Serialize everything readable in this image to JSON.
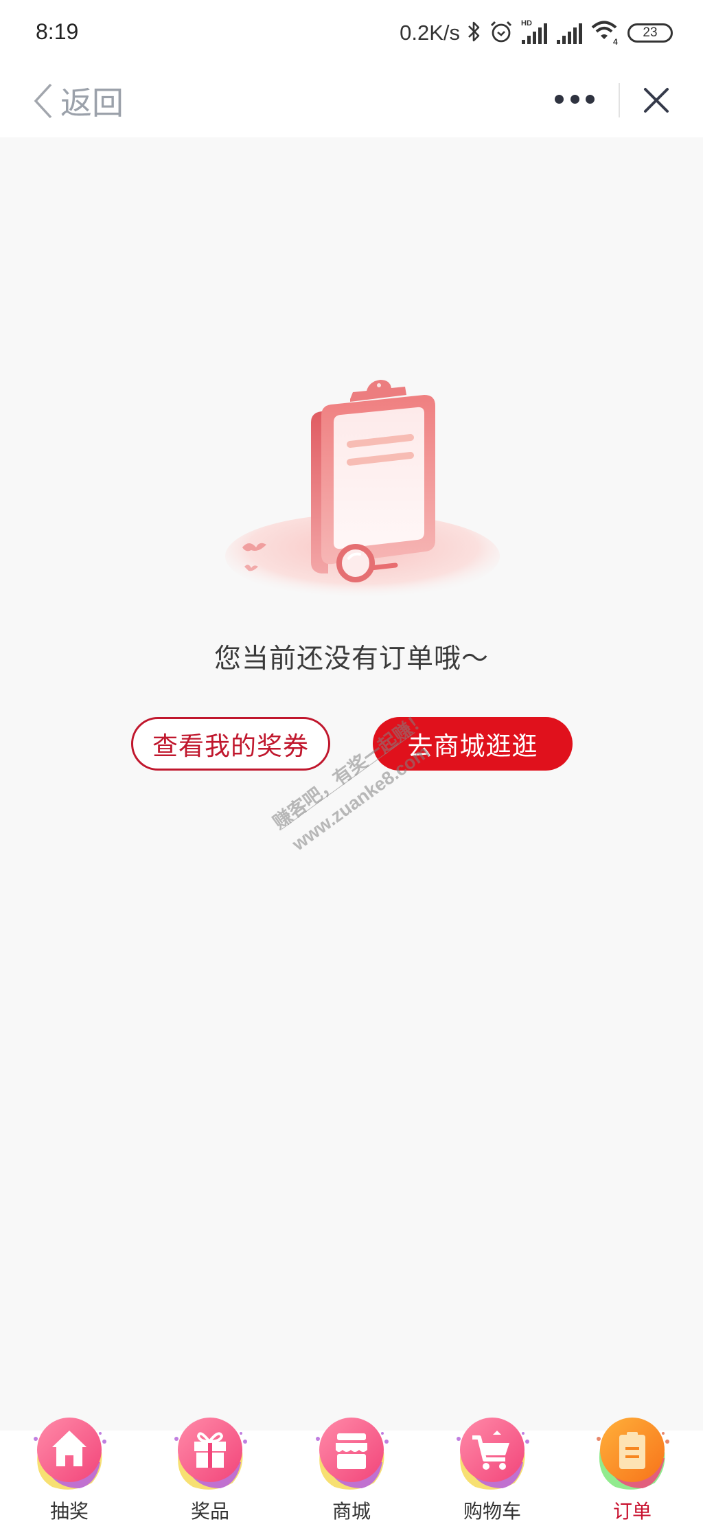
{
  "status_bar": {
    "time": "8:19",
    "network_speed": "0.2K/s",
    "icons": [
      "bluetooth-icon",
      "alarm-icon",
      "signal-hd-icon",
      "signal-icon",
      "wifi-icon"
    ],
    "wifi_badge": "4",
    "hd_badge": "HD",
    "battery": "23"
  },
  "header": {
    "back_label": "返回",
    "more_icon": "more-dots-icon",
    "close_icon": "close-icon"
  },
  "empty_state": {
    "illustration": "clipboard-magnifier-illustration",
    "message": "您当前还没有订单哦～",
    "secondary_button": "查看我的奖券",
    "primary_button": "去商城逛逛"
  },
  "watermark": {
    "line1": "赚客吧，有奖一起赚！",
    "line2": "www.zuanke8.com"
  },
  "tabbar": {
    "items": [
      {
        "label": "抽奖",
        "icon": "home-icon",
        "active": false
      },
      {
        "label": "奖品",
        "icon": "gift-icon",
        "active": false
      },
      {
        "label": "商城",
        "icon": "store-icon",
        "active": false
      },
      {
        "label": "购物车",
        "icon": "cart-icon",
        "active": false
      },
      {
        "label": "订单",
        "icon": "clipboard-icon",
        "active": true
      }
    ]
  },
  "colors": {
    "brand_red": "#e0111c",
    "outline_red": "#c0172d",
    "active_tab_label": "#c8102e",
    "page_background": "#f8f8f8"
  }
}
